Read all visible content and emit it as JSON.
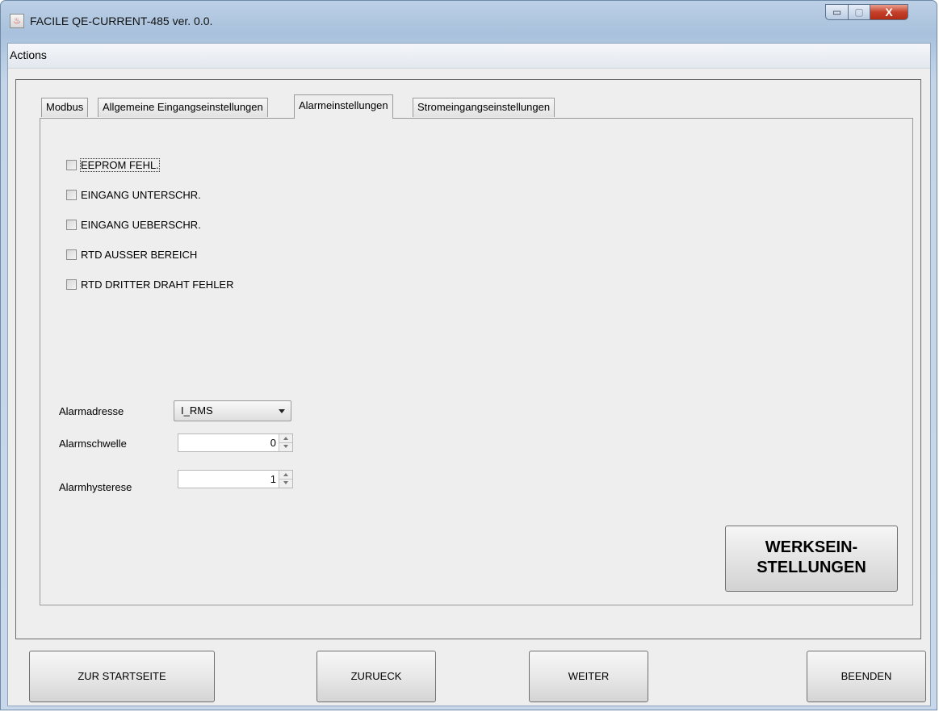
{
  "window": {
    "title": "FACILE QE-CURRENT-485 ver. 0.0.",
    "min_glyph": "▭",
    "max_glyph": "▢",
    "close_glyph": "X",
    "app_icon": "java-cup-icon"
  },
  "menubar": {
    "items": [
      {
        "label": "Actions"
      }
    ]
  },
  "tabs": [
    {
      "label": "Modbus",
      "active": false
    },
    {
      "label": "Allgemeine Eingangseinstellungen",
      "active": false
    },
    {
      "label": "Alarmeinstellungen",
      "active": true
    },
    {
      "label": "Stromeingangseinstellungen",
      "active": false
    }
  ],
  "alarms": [
    {
      "label": "EEPROM FEHL.",
      "checked": false
    },
    {
      "label": "EINGANG UNTERSCHR.",
      "checked": false
    },
    {
      "label": "EINGANG UEBERSCHR.",
      "checked": false
    },
    {
      "label": "RTD AUSSER BEREICH",
      "checked": false
    },
    {
      "label": "RTD DRITTER DRAHT FEHLER",
      "checked": false
    }
  ],
  "fields": {
    "address": {
      "label": "Alarmadresse",
      "value": "I_RMS"
    },
    "threshold": {
      "label": "Alarmschwelle",
      "value": "0"
    },
    "hysteresis": {
      "label": "Alarmhysterese",
      "value": "1"
    }
  },
  "factory_button": {
    "line1": "WERKSEIN-",
    "line2": "STELLUNGEN"
  },
  "nav": {
    "home": "ZUR STARTSEITE",
    "back": "ZURUECK",
    "next": "WEITER",
    "quit": "BEENDEN"
  }
}
